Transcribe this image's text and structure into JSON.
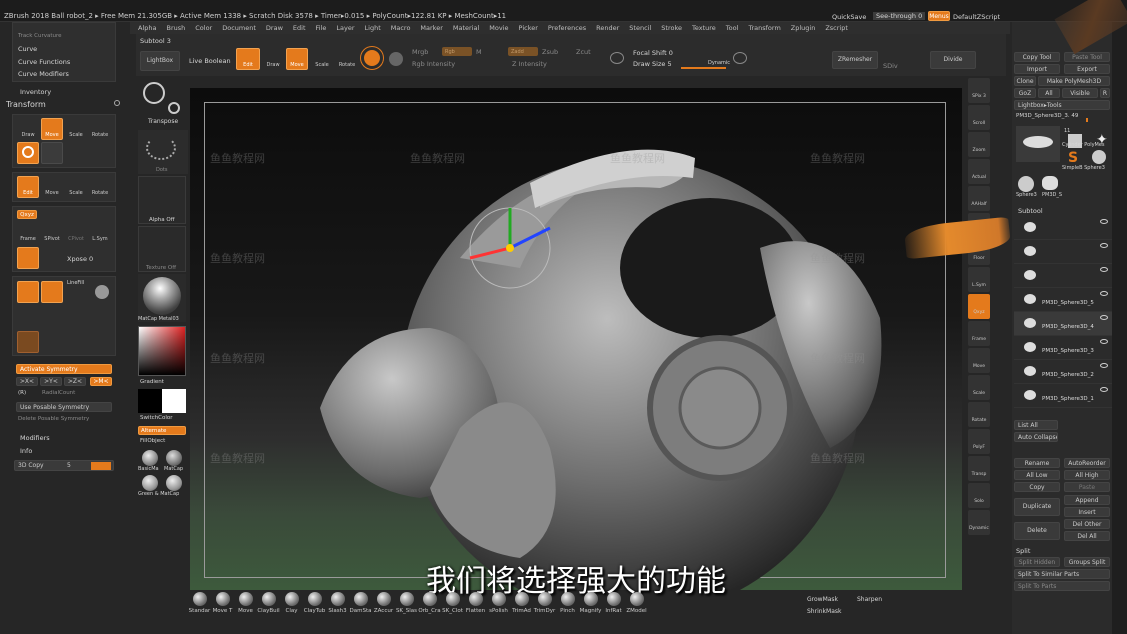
{
  "titlebar": {
    "text": "ZBrush 2018   Ball robot_2   ▸ Free Mem 21.305GB ▸ Active Mem 1338 ▸ Scratch Disk 3578 ▸ Timer▸0.015 ▸ PolyCount▸122.81 KP ▸ MeshCount▸11",
    "quicksave": "QuickSave",
    "seethrough": "See-through  0",
    "menus": "Menus",
    "default": "DefaultZScript"
  },
  "menubar": [
    "Alpha",
    "Brush",
    "Color",
    "Document",
    "Draw",
    "Edit",
    "File",
    "Layer",
    "Light",
    "Macro",
    "Marker",
    "Material",
    "Movie",
    "Picker",
    "Preferences",
    "Render",
    "Stencil",
    "Stroke",
    "Texture",
    "Tool",
    "Transform",
    "Zplugin",
    "Zscript"
  ],
  "toolbar": {
    "subtool": "Subtool 3",
    "lightbox": "LightBox",
    "liveboolean": "Live Boolean",
    "edit": "Edit",
    "draw": "Draw",
    "move": "Move",
    "scale": "Scale",
    "rotate": "Rotate",
    "mrgb": "Mrgb",
    "rgb": "Rgb",
    "m": "M",
    "zadd": "Zadd",
    "zsub": "Zsub",
    "zcut": "Zcut",
    "rgbintensity": "Rgb Intensity",
    "zintensity": "Z Intensity",
    "focalshift": "Focal Shift 0",
    "drawsize": "Draw Size 5",
    "dynamic": "Dynamic",
    "zremesher": "ZRemesher",
    "divide": "Divide",
    "sdiv": "SDiv"
  },
  "leftpanel": {
    "trackcurvature": "Track Curvature",
    "curve": "Curve",
    "curvefunctions": "Curve Functions",
    "curvemodifiers": "Curve Modifiers",
    "inventory": "Inventory",
    "transform": "Transform",
    "drw": "Draw",
    "move": "Move",
    "scale": "Scale",
    "rotate": "Rotate",
    "edit": "Edit",
    "move2": "Move",
    "scale2": "Scale",
    "rotate2": "Rotate",
    "qxyz": "Qxyz",
    "frame": "Frame",
    "spivot": "SPivot",
    "cpivot": "CPivot",
    "lsym": "L.Sym",
    "xpose": "Xpose 0",
    "lunit": "LineFill",
    "activatesym": "Activate Symmetry",
    "x": ">X<",
    "y": ">Y<",
    "z": ">Z<",
    "m": ">M<",
    "r": "(R)",
    "radialcount": "RadialCount",
    "useposable": "Use Posable Symmetry",
    "deleteposable": "Delete Posable Symmetry",
    "modifiers": "Modifiers",
    "info": "Info",
    "copy3d": "3D Copy",
    "copyval": "5"
  },
  "leftcol2": {
    "transpose": "Transpose",
    "dots": "Dots",
    "alphaoff": "Alpha Off",
    "textureoff": "Texture Off",
    "matcap": "MatCap Metal03",
    "gradient": "Gradient",
    "switchcolor": "SwitchColor",
    "alternate": "Alternate",
    "fillobject": "FillObject",
    "basicmat": "BasicMa",
    "matcapgray": "MatCap",
    "green": "Green & MatCap"
  },
  "rightstrip": [
    "SPix 3",
    "Scroll",
    "Zoom",
    "Actual",
    "AAHalf",
    "Persp",
    "Floor",
    "L.Sym",
    "Qxyz",
    "Frame",
    "Move",
    "Scale",
    "Rotate",
    "PolyF",
    "Transp",
    "Solo",
    "Dynamic"
  ],
  "rightpanel": {
    "load": "Load Tool",
    "save": "Save As",
    "copy": "Copy Tool",
    "paste": "Paste Tool",
    "import": "Import",
    "export": "Export",
    "clone": "Clone",
    "makepolymesh": "Make PolyMesh3D",
    "goz": "GoZ",
    "all": "All",
    "visible": "Visible",
    "r": "R",
    "lightboxtools": "Lightbox▸Tools",
    "toolname": "PM3D_Sphere3D_3. 49",
    "count": "11",
    "cylinder": "Cylinder PolyMes",
    "simpleb": "SimpleB Sphere3",
    "pm3d1": "PM3D_S",
    "sphere": "Sphere3",
    "pm2": "PM3D_3",
    "subtool": "Subtool",
    "subtools": [
      "",
      "",
      "",
      "PM3D_Sphere3D_5",
      "PM3D_Sphere3D_4",
      "PM3D_Sphere3D_3",
      "PM3D_Sphere3D_2",
      "PM3D_Sphere3D_1"
    ],
    "listall": "List All",
    "autocollapse": "Auto Collapse",
    "rename": "Rename",
    "autoreorder": "AutoReorder",
    "alllow": "All Low",
    "allhigh": "All High",
    "copy2": "Copy",
    "paste2": "Paste",
    "duplicate": "Duplicate",
    "append": "Append",
    "insert": "Insert",
    "delete": "Delete",
    "delother": "Del Other",
    "delall": "Del All",
    "split": "Split",
    "splithidden": "Split Hidden",
    "groupssplit": "Groups Split",
    "splitsimilar": "Split To Similar Parts",
    "splitparts": "Split To Parts"
  },
  "brushes": [
    "Standar",
    "Move T",
    "Move",
    "ClayBuil",
    "Clay",
    "ClayTub",
    "Slash3",
    "DamSta",
    "ZAccur",
    "SK_Slas",
    "Orb_Cra",
    "SK_Clot",
    "Flatten",
    "sPolish",
    "TrimAd",
    "TrimDyr",
    "Pinch",
    "Magnify",
    "InfRat",
    "ZModel"
  ],
  "bottomright": {
    "growmask": "GrowMask",
    "shrinkmask": "ShrinkMask",
    "sharpen": "Sharpen"
  },
  "subtitle": "我们将选择强大的功能",
  "watermark": "鱼鱼教程网"
}
